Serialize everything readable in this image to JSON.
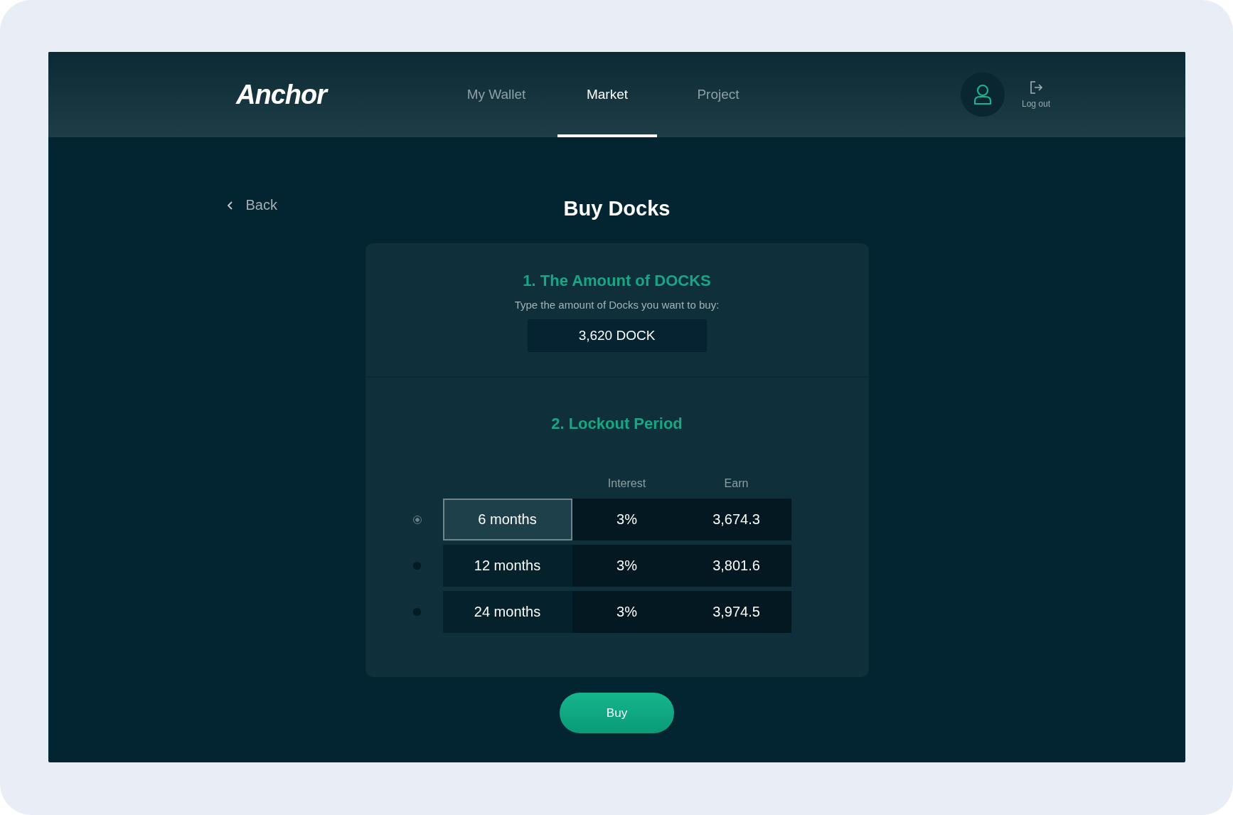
{
  "header": {
    "logo": "Anchor",
    "tabs": [
      {
        "label": "My Wallet",
        "selected": false
      },
      {
        "label": "Market",
        "selected": true
      },
      {
        "label": "Project",
        "selected": false
      }
    ],
    "logout": "Log out"
  },
  "back": "Back",
  "title": "Buy Docks",
  "amount_section": {
    "heading": "1. The Amount of DOCKS",
    "hint": "Type the amount of Docks you want to buy:",
    "value": "3,620 DOCK"
  },
  "lockout_section": {
    "heading": "2. Lockout Period",
    "columns": [
      "Interest",
      "Earn"
    ],
    "rows": [
      {
        "period": "6 months",
        "interest": "3%",
        "earn": "3,674.3",
        "selected": true
      },
      {
        "period": "12 months",
        "interest": "3%",
        "earn": "3,801.6",
        "selected": false
      },
      {
        "period": "24 months",
        "interest": "3%",
        "earn": "3,974.5",
        "selected": false
      }
    ]
  },
  "buy_button": "Buy"
}
